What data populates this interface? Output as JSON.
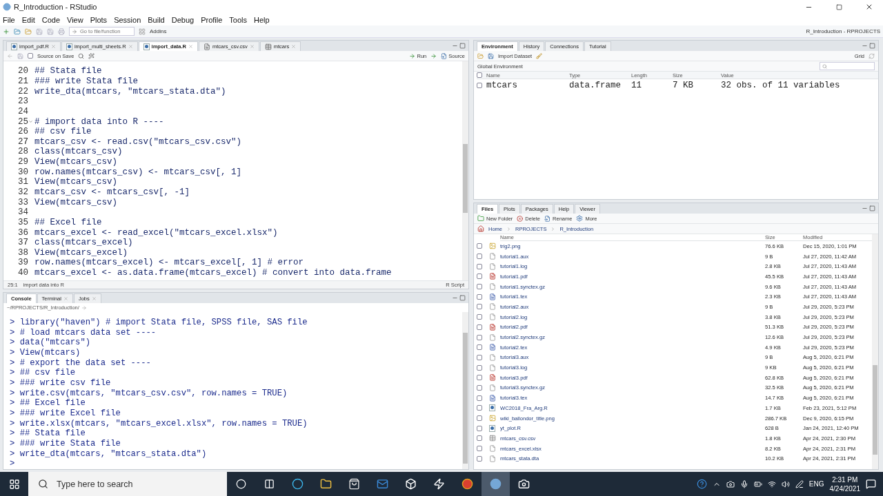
{
  "window": {
    "title": "R_Introduction - RStudio"
  },
  "menu": [
    "File",
    "Edit",
    "Code",
    "View",
    "Plots",
    "Session",
    "Build",
    "Debug",
    "Profile",
    "Tools",
    "Help"
  ],
  "toolbar": {
    "goto_placeholder": "Go to file/function",
    "addins": "Addins",
    "project": "R_Introduction - RPROJECTS"
  },
  "editor": {
    "tabs": [
      {
        "label": "import_pdf.R",
        "kind": "r",
        "selected": false
      },
      {
        "label": "import_multi_sheets.R",
        "kind": "r",
        "selected": false
      },
      {
        "label": "import_data.R",
        "kind": "r",
        "selected": true
      },
      {
        "label": "mtcars_csv.csv",
        "kind": "text",
        "selected": false
      },
      {
        "label": "mtcars",
        "kind": "data",
        "selected": false
      }
    ],
    "source_on_save": {
      "label": "Source on Save",
      "checked": false
    },
    "run": "Run",
    "source": "Source",
    "lines": [
      {
        "num": "20",
        "code": "## Stata file",
        "fold": false
      },
      {
        "num": "21",
        "code": "### write Stata file",
        "fold": false
      },
      {
        "num": "22",
        "code": "write_dta(mtcars, \"mtcars_stata.dta\")",
        "fold": false
      },
      {
        "num": "23",
        "fold": false
      },
      {
        "num": "24",
        "fold": false
      },
      {
        "num": "25",
        "code": "# import data into R ----",
        "fold": true
      },
      {
        "num": "26",
        "code": "## csv file",
        "fold": false
      },
      {
        "num": "27",
        "code": "mtcars_csv <- read.csv(\"mtcars_csv.csv\")",
        "fold": false
      },
      {
        "num": "28",
        "code": "class(mtcars_csv)",
        "fold": false
      },
      {
        "num": "29",
        "code": "View(mtcars_csv)",
        "fold": false
      },
      {
        "num": "30",
        "code": "row.names(mtcars_csv) <- mtcars_csv[, 1]",
        "fold": false
      },
      {
        "num": "31",
        "code": "View(mtcars_csv)",
        "fold": false
      },
      {
        "num": "32",
        "code": "mtcars_csv <- mtcars_csv[, -1]",
        "fold": false
      },
      {
        "num": "33",
        "code": "View(mtcars_csv)",
        "fold": false
      },
      {
        "num": "34",
        "fold": false
      },
      {
        "num": "35",
        "code": "## Excel file",
        "fold": false
      },
      {
        "num": "36",
        "code": "mtcars_excel <- read_excel(\"mtcars_excel.xlsx\")",
        "fold": false
      },
      {
        "num": "37",
        "code": "class(mtcars_excel)",
        "fold": false
      },
      {
        "num": "38",
        "code": "View(mtcars_excel)",
        "fold": false
      },
      {
        "num": "39",
        "code": "row.names(mtcars_excel) <- mtcars_excel[, 1] # error",
        "fold": false
      },
      {
        "num": "40",
        "code": "mtcars_excel <- as.data.frame(mtcars_excel) # convert into data.frame",
        "fold": false
      }
    ],
    "status": {
      "position": "25:1",
      "section": "import data into R",
      "type": "R Script"
    }
  },
  "console": {
    "tabs": [
      {
        "label": "Console",
        "closable": false,
        "selected": true
      },
      {
        "label": "Terminal",
        "closable": true,
        "selected": false
      },
      {
        "label": "Jobs",
        "closable": true,
        "selected": false
      }
    ],
    "path": "~/RPROJECTS/R_Introduction/",
    "lines": [
      "> library(\"haven\") # import Stata file, SPSS file, SAS file",
      "> # load mtcars data set ----",
      "> data(\"mtcars\")",
      "> View(mtcars)",
      "> # export the data set ----",
      "> ## csv file",
      "> ### write csv file",
      "> write.csv(mtcars, \"mtcars_csv.csv\", row.names = TRUE)",
      "> ## Excel file",
      "> ### write Excel file",
      "> write.xlsx(mtcars, \"mtcars_excel.xlsx\", row.names = TRUE)",
      "> ## Stata file",
      "> ### write Stata file",
      "> write_dta(mtcars, \"mtcars_stata.dta\")",
      ">"
    ]
  },
  "environment": {
    "tabs": [
      {
        "label": "Environment",
        "selected": true
      },
      {
        "label": "History",
        "selected": false
      },
      {
        "label": "Connections",
        "selected": false
      },
      {
        "label": "Tutorial",
        "selected": false
      }
    ],
    "import": "Import Dataset",
    "view": "Grid",
    "scope": "Global Environment",
    "all_checked": false,
    "columns": [
      "Name",
      "Type",
      "Length",
      "Size",
      "Value"
    ],
    "rows": [
      {
        "name": "mtcars",
        "type": "data.frame",
        "length": "11",
        "size": "7 KB",
        "value": "32 obs. of 11 variables",
        "checked": false
      }
    ]
  },
  "files": {
    "tabs": [
      {
        "label": "Files",
        "selected": true
      },
      {
        "label": "Plots",
        "selected": false
      },
      {
        "label": "Packages",
        "selected": false
      },
      {
        "label": "Help",
        "selected": false
      },
      {
        "label": "Viewer",
        "selected": false
      }
    ],
    "actions": [
      {
        "label": "New Folder",
        "kind": "folder"
      },
      {
        "label": "Delete",
        "kind": "delete"
      },
      {
        "label": "Rename",
        "kind": "rename"
      },
      {
        "label": "More",
        "kind": "more"
      }
    ],
    "breadcrumb": [
      "Home",
      "RPROJECTS",
      "R_Introduction"
    ],
    "columns": [
      "Name",
      "Size",
      "Modified"
    ],
    "rows": [
      {
        "kind": "image",
        "name": "trig2.png",
        "size": "76.6 KB",
        "modified": "Dec 15, 2020, 1:01 PM",
        "checked": false
      },
      {
        "kind": "file",
        "name": "tutorial1.aux",
        "size": "9 B",
        "modified": "Jul 27, 2020, 11:42 AM",
        "checked": false
      },
      {
        "kind": "file",
        "name": "tutorial1.log",
        "size": "2.8 KB",
        "modified": "Jul 27, 2020, 11:43 AM",
        "checked": false
      },
      {
        "kind": "pdf",
        "name": "tutorial1.pdf",
        "size": "45.5 KB",
        "modified": "Jul 27, 2020, 11:43 AM",
        "checked": false
      },
      {
        "kind": "file",
        "name": "tutorial1.synctex.gz",
        "size": "9.6 KB",
        "modified": "Jul 27, 2020, 11:43 AM",
        "checked": false
      },
      {
        "kind": "tex",
        "name": "tutorial1.tex",
        "size": "2.3 KB",
        "modified": "Jul 27, 2020, 11:43 AM",
        "checked": false
      },
      {
        "kind": "file",
        "name": "tutorial2.aux",
        "size": "9 B",
        "modified": "Jul 29, 2020, 5:23 PM",
        "checked": false
      },
      {
        "kind": "file",
        "name": "tutorial2.log",
        "size": "3.8 KB",
        "modified": "Jul 29, 2020, 5:23 PM",
        "checked": false
      },
      {
        "kind": "pdf",
        "name": "tutorial2.pdf",
        "size": "51.3 KB",
        "modified": "Jul 29, 2020, 5:23 PM",
        "checked": false
      },
      {
        "kind": "file",
        "name": "tutorial2.synctex.gz",
        "size": "12.6 KB",
        "modified": "Jul 29, 2020, 5:23 PM",
        "checked": false
      },
      {
        "kind": "tex",
        "name": "tutorial2.tex",
        "size": "4.9 KB",
        "modified": "Jul 29, 2020, 5:23 PM",
        "checked": false
      },
      {
        "kind": "file",
        "name": "tutorial3.aux",
        "size": "9 B",
        "modified": "Aug 5, 2020, 6:21 PM",
        "checked": false
      },
      {
        "kind": "file",
        "name": "tutorial3.log",
        "size": "9 KB",
        "modified": "Aug 5, 2020, 6:21 PM",
        "checked": false
      },
      {
        "kind": "pdf",
        "name": "tutorial3.pdf",
        "size": "62.8 KB",
        "modified": "Aug 5, 2020, 6:21 PM",
        "checked": false
      },
      {
        "kind": "file",
        "name": "tutorial3.synctex.gz",
        "size": "32.5 KB",
        "modified": "Aug 5, 2020, 6:21 PM",
        "checked": false
      },
      {
        "kind": "tex",
        "name": "tutorial3.tex",
        "size": "14.7 KB",
        "modified": "Aug 5, 2020, 6:21 PM",
        "checked": false
      },
      {
        "kind": "r",
        "name": "WC2018_Fra_Arg.R",
        "size": "1.7 KB",
        "modified": "Feb 23, 2021, 5:12 PM",
        "checked": false
      },
      {
        "kind": "image",
        "name": "wiki_ballondor_title.png",
        "size": "286.7 KB",
        "modified": "Dec 9, 2020, 6:15 PM",
        "checked": false
      },
      {
        "kind": "r",
        "name": "yt_plot.R",
        "size": "628 B",
        "modified": "Jan 24, 2021, 12:40 PM",
        "checked": false
      },
      {
        "kind": "table",
        "name": "mtcars_csv.csv",
        "size": "1.8 KB",
        "modified": "Apr 24, 2021, 2:30 PM",
        "checked": false
      },
      {
        "kind": "file",
        "name": "mtcars_excel.xlsx",
        "size": "8.2 KB",
        "modified": "Apr 24, 2021, 2:31 PM",
        "checked": false
      },
      {
        "kind": "file",
        "name": "mtcars_stata.dta",
        "size": "10.2 KB",
        "modified": "Apr 24, 2021, 2:31 PM",
        "checked": false
      }
    ]
  },
  "taskbar": {
    "search_placeholder": "Type here to search",
    "language": "ENG",
    "time": "2:31 PM",
    "date": "4/24/2021"
  }
}
